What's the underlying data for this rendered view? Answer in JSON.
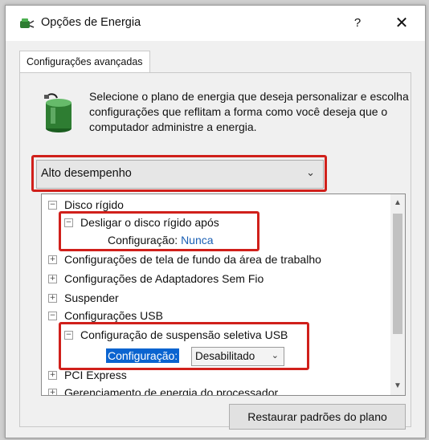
{
  "window": {
    "title": "Opções de Energia",
    "help_label": "?",
    "close_label": "✕",
    "title_icon": "power-options-icon"
  },
  "tab": {
    "label": "Configurações avançadas"
  },
  "description": "Selecione o plano de energia que deseja personalizar e escolha configurações que reflitam a forma como você deseja que o computador administre a energia.",
  "plan_select": {
    "value": "Alto desempenho",
    "icon": "chevron-down-icon"
  },
  "tree": {
    "items": [
      {
        "label": "Disco rígido",
        "expander": "⊟"
      },
      {
        "label": "Desligar o disco rígido após",
        "expander": "⊟"
      },
      {
        "setting_label": "Configuração:",
        "setting_value": "Nunca"
      },
      {
        "label": "Configurações de tela de fundo da área de trabalho",
        "expander": "⊞"
      },
      {
        "label": "Configurações de Adaptadores Sem Fio",
        "expander": "⊞"
      },
      {
        "label": "Suspender",
        "expander": "⊞"
      },
      {
        "label": "Configurações USB",
        "expander": "⊟"
      },
      {
        "label": "Configuração de suspensão seletiva USB",
        "expander": "⊟"
      },
      {
        "setting_label": "Configuração:",
        "setting_value": "Desabilitado"
      },
      {
        "label": "PCI Express",
        "expander": "⊞"
      },
      {
        "label": "Gerenciamento de energia do processador",
        "expander": "⊞"
      }
    ]
  },
  "restore_button": "Restaurar padrões do plano",
  "colors": {
    "highlight": "#d0201b",
    "link": "#1a5fb4",
    "selection": "#0a64d0"
  }
}
